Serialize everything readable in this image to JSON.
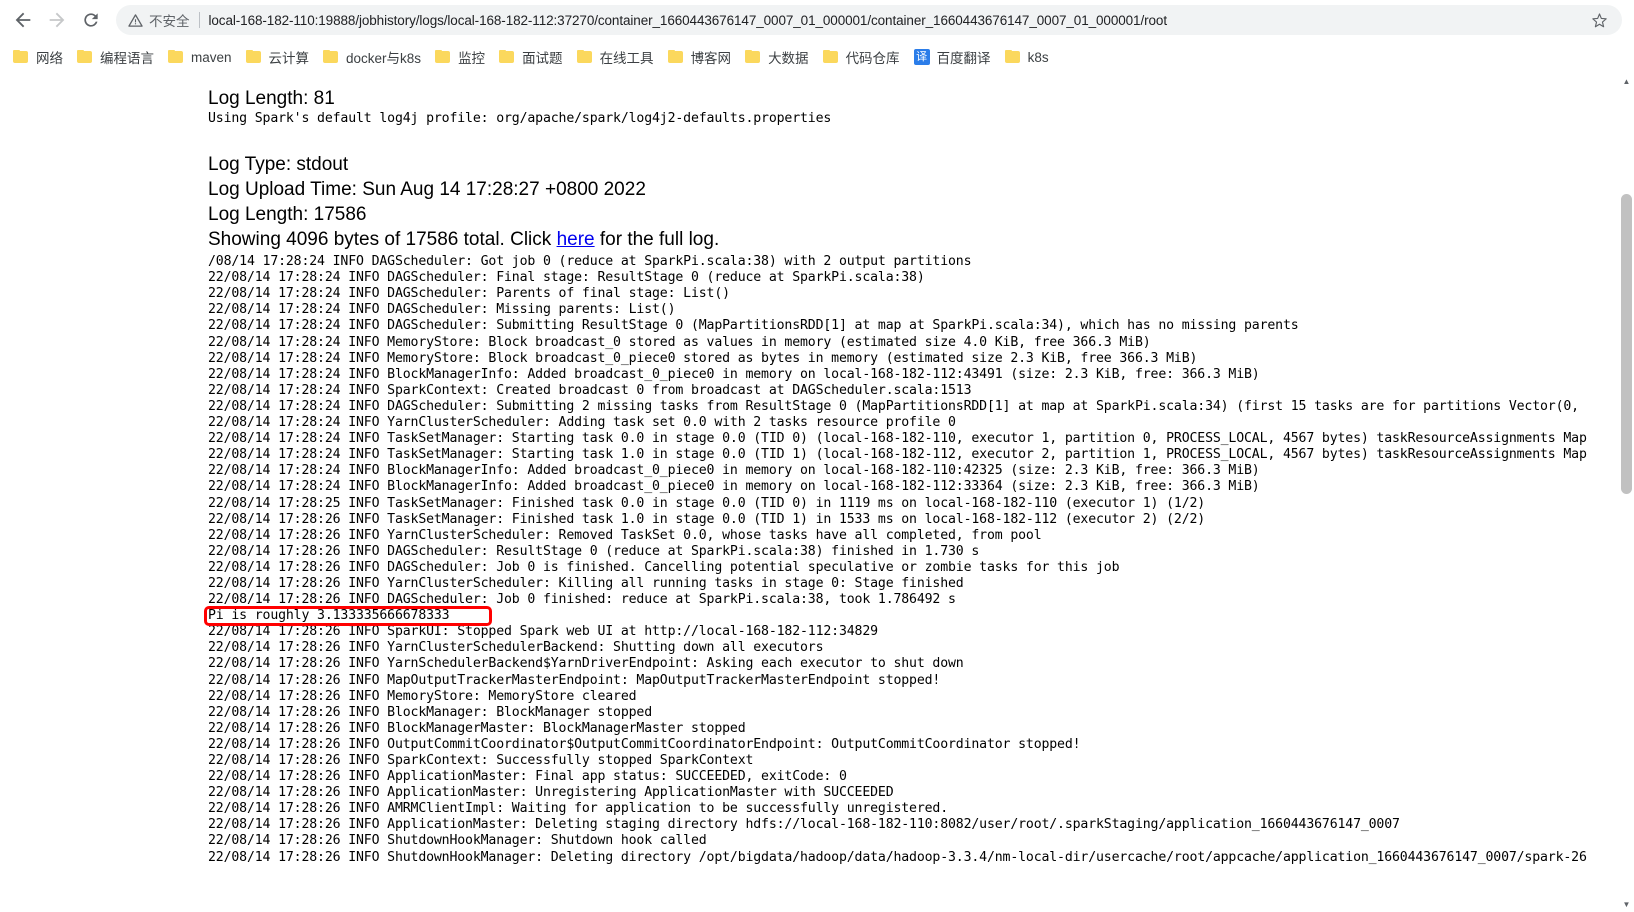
{
  "browser": {
    "back_icon": "arrow-left-icon",
    "forward_icon": "arrow-right-icon",
    "reload_icon": "reload-icon",
    "security_icon": "warning-triangle-icon",
    "security_label": "不安全",
    "url": "local-168-182-110:19888/jobhistory/logs/local-168-182-112:37270/container_1660443676147_0007_01_000001/container_1660443676147_0007_01_000001/root",
    "star_icon": "bookmark-star-icon"
  },
  "bookmarks": [
    {
      "label": "网络",
      "icon": "folder-icon"
    },
    {
      "label": "编程语言",
      "icon": "folder-icon"
    },
    {
      "label": "maven",
      "icon": "folder-icon"
    },
    {
      "label": "云计算",
      "icon": "folder-icon"
    },
    {
      "label": "docker与k8s",
      "icon": "folder-icon"
    },
    {
      "label": "监控",
      "icon": "folder-icon"
    },
    {
      "label": "面试题",
      "icon": "folder-icon"
    },
    {
      "label": "在线工具",
      "icon": "folder-icon"
    },
    {
      "label": "博客网",
      "icon": "folder-icon"
    },
    {
      "label": "大数据",
      "icon": "folder-icon"
    },
    {
      "label": "代码仓库",
      "icon": "folder-icon"
    },
    {
      "label": "百度翻译",
      "icon": "translate-icon",
      "icon_glyph": "译"
    },
    {
      "label": "k8s",
      "icon": "folder-icon"
    }
  ],
  "log_page": {
    "stderr_log_length_label": "Log Length: 81",
    "stderr_content": "Using Spark's default log4j profile: org/apache/spark/log4j2-defaults.properties",
    "stdout_log_type": "Log Type: stdout",
    "stdout_upload_time": "Log Upload Time: Sun Aug 14 17:28:27 +0800 2022",
    "stdout_log_length": "Log Length: 17586",
    "showing_prefix": "Showing 4096 bytes of 17586 total. Click ",
    "showing_link": "here",
    "showing_suffix": " for the full log.",
    "highlight_color": "#ff0000",
    "lines": [
      "/08/14 17:28:24 INFO DAGScheduler: Got job 0 (reduce at SparkPi.scala:38) with 2 output partitions",
      "22/08/14 17:28:24 INFO DAGScheduler: Final stage: ResultStage 0 (reduce at SparkPi.scala:38)",
      "22/08/14 17:28:24 INFO DAGScheduler: Parents of final stage: List()",
      "22/08/14 17:28:24 INFO DAGScheduler: Missing parents: List()",
      "22/08/14 17:28:24 INFO DAGScheduler: Submitting ResultStage 0 (MapPartitionsRDD[1] at map at SparkPi.scala:34), which has no missing parents",
      "22/08/14 17:28:24 INFO MemoryStore: Block broadcast_0 stored as values in memory (estimated size 4.0 KiB, free 366.3 MiB)",
      "22/08/14 17:28:24 INFO MemoryStore: Block broadcast_0_piece0 stored as bytes in memory (estimated size 2.3 KiB, free 366.3 MiB)",
      "22/08/14 17:28:24 INFO BlockManagerInfo: Added broadcast_0_piece0 in memory on local-168-182-112:43491 (size: 2.3 KiB, free: 366.3 MiB)",
      "22/08/14 17:28:24 INFO SparkContext: Created broadcast 0 from broadcast at DAGScheduler.scala:1513",
      "22/08/14 17:28:24 INFO DAGScheduler: Submitting 2 missing tasks from ResultStage 0 (MapPartitionsRDD[1] at map at SparkPi.scala:34) (first 15 tasks are for partitions Vector(0,",
      "22/08/14 17:28:24 INFO YarnClusterScheduler: Adding task set 0.0 with 2 tasks resource profile 0",
      "22/08/14 17:28:24 INFO TaskSetManager: Starting task 0.0 in stage 0.0 (TID 0) (local-168-182-110, executor 1, partition 0, PROCESS_LOCAL, 4567 bytes) taskResourceAssignments Map",
      "22/08/14 17:28:24 INFO TaskSetManager: Starting task 1.0 in stage 0.0 (TID 1) (local-168-182-112, executor 2, partition 1, PROCESS_LOCAL, 4567 bytes) taskResourceAssignments Map",
      "22/08/14 17:28:24 INFO BlockManagerInfo: Added broadcast_0_piece0 in memory on local-168-182-110:42325 (size: 2.3 KiB, free: 366.3 MiB)",
      "22/08/14 17:28:24 INFO BlockManagerInfo: Added broadcast_0_piece0 in memory on local-168-182-112:33364 (size: 2.3 KiB, free: 366.3 MiB)",
      "22/08/14 17:28:25 INFO TaskSetManager: Finished task 0.0 in stage 0.0 (TID 0) in 1119 ms on local-168-182-110 (executor 1) (1/2)",
      "22/08/14 17:28:26 INFO TaskSetManager: Finished task 1.0 in stage 0.0 (TID 1) in 1533 ms on local-168-182-112 (executor 2) (2/2)",
      "22/08/14 17:28:26 INFO YarnClusterScheduler: Removed TaskSet 0.0, whose tasks have all completed, from pool",
      "22/08/14 17:28:26 INFO DAGScheduler: ResultStage 0 (reduce at SparkPi.scala:38) finished in 1.730 s",
      "22/08/14 17:28:26 INFO DAGScheduler: Job 0 is finished. Cancelling potential speculative or zombie tasks for this job",
      "22/08/14 17:28:26 INFO YarnClusterScheduler: Killing all running tasks in stage 0: Stage finished",
      "22/08/14 17:28:26 INFO DAGScheduler: Job 0 finished: reduce at SparkPi.scala:38, took 1.786492 s",
      "Pi is roughly 3.133335666678333",
      "22/08/14 17:28:26 INFO SparkUI: Stopped Spark web UI at http://local-168-182-112:34829",
      "22/08/14 17:28:26 INFO YarnClusterSchedulerBackend: Shutting down all executors",
      "22/08/14 17:28:26 INFO YarnSchedulerBackend$YarnDriverEndpoint: Asking each executor to shut down",
      "22/08/14 17:28:26 INFO MapOutputTrackerMasterEndpoint: MapOutputTrackerMasterEndpoint stopped!",
      "22/08/14 17:28:26 INFO MemoryStore: MemoryStore cleared",
      "22/08/14 17:28:26 INFO BlockManager: BlockManager stopped",
      "22/08/14 17:28:26 INFO BlockManagerMaster: BlockManagerMaster stopped",
      "22/08/14 17:28:26 INFO OutputCommitCoordinator$OutputCommitCoordinatorEndpoint: OutputCommitCoordinator stopped!",
      "22/08/14 17:28:26 INFO SparkContext: Successfully stopped SparkContext",
      "22/08/14 17:28:26 INFO ApplicationMaster: Final app status: SUCCEEDED, exitCode: 0",
      "22/08/14 17:28:26 INFO ApplicationMaster: Unregistering ApplicationMaster with SUCCEEDED",
      "22/08/14 17:28:26 INFO AMRMClientImpl: Waiting for application to be successfully unregistered.",
      "22/08/14 17:28:26 INFO ApplicationMaster: Deleting staging directory hdfs://local-168-182-110:8082/user/root/.sparkStaging/application_1660443676147_0007",
      "22/08/14 17:28:26 INFO ShutdownHookManager: Shutdown hook called",
      "22/08/14 17:28:26 INFO ShutdownHookManager: Deleting directory /opt/bigdata/hadoop/data/hadoop-3.3.4/nm-local-dir/usercache/root/appcache/application_1660443676147_0007/spark-26"
    ],
    "highlighted_line_index": 22
  }
}
